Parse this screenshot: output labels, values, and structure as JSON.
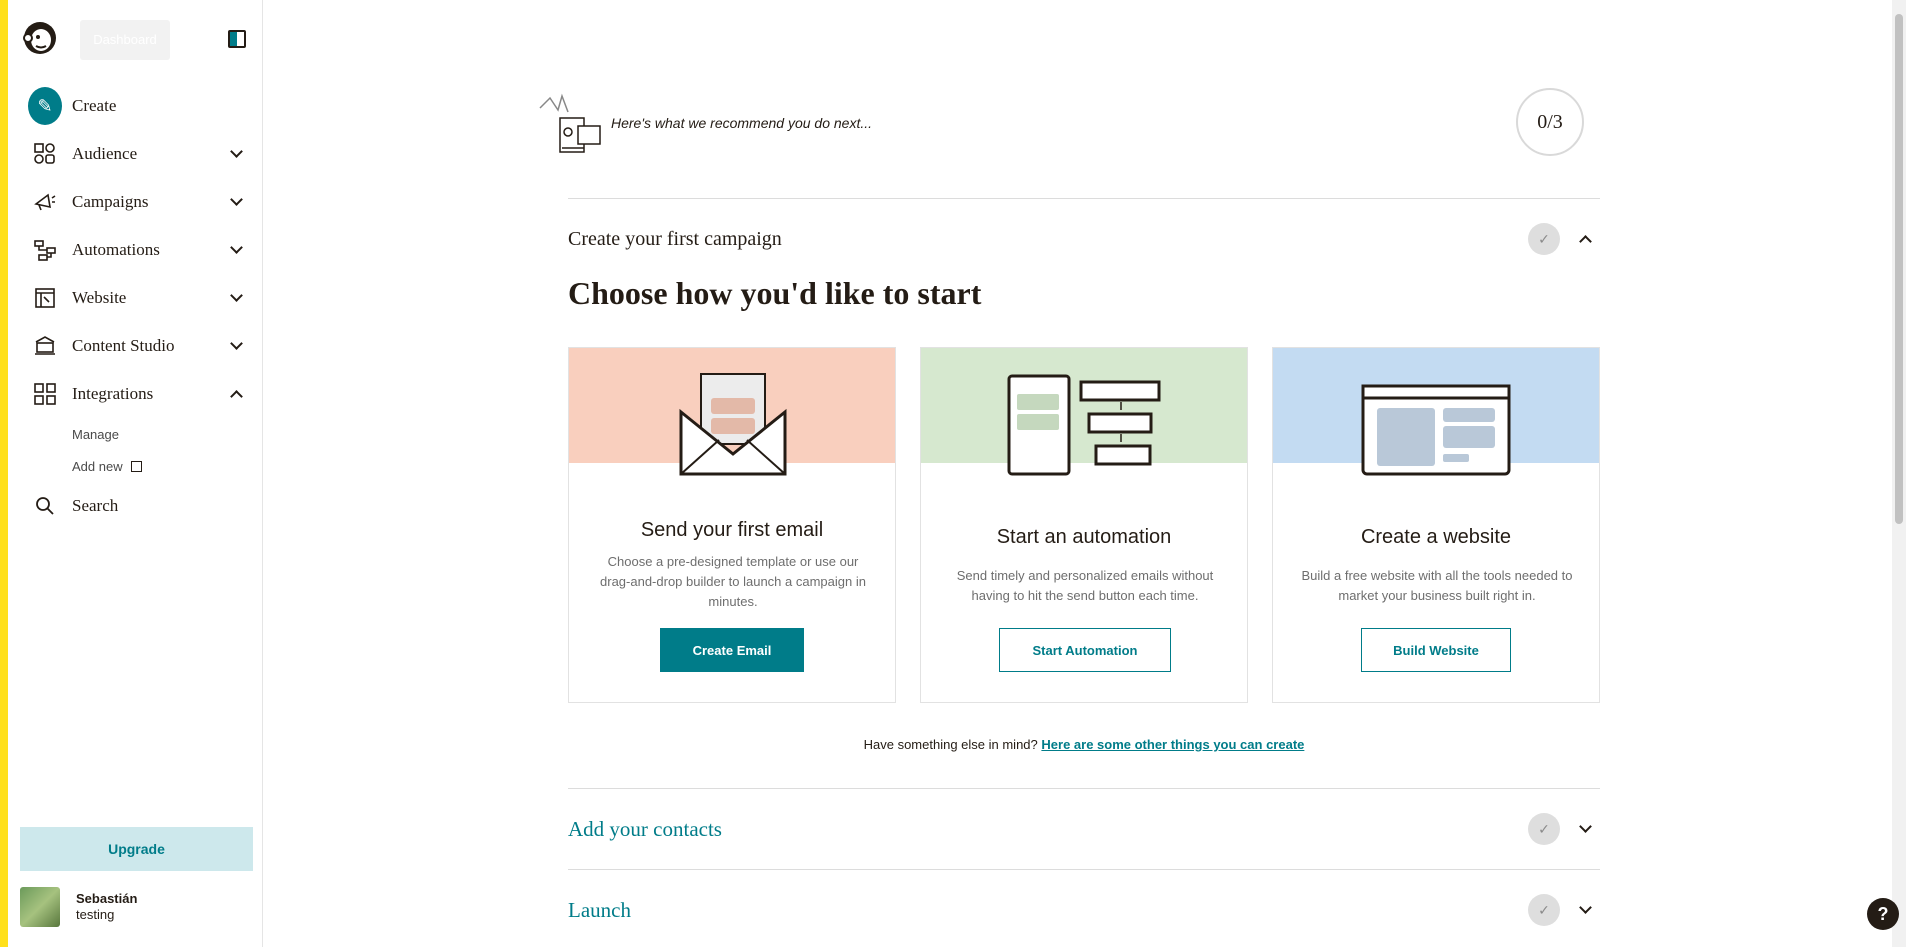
{
  "sidebar": {
    "tooltip": "Dashboard",
    "items": [
      {
        "label": "Create",
        "icon": "pencil-icon"
      },
      {
        "label": "Audience",
        "icon": "audience-icon"
      },
      {
        "label": "Campaigns",
        "icon": "megaphone-icon"
      },
      {
        "label": "Automations",
        "icon": "automation-icon"
      },
      {
        "label": "Website",
        "icon": "website-icon"
      },
      {
        "label": "Content Studio",
        "icon": "content-studio-icon"
      },
      {
        "label": "Integrations",
        "icon": "grid-icon"
      }
    ],
    "integrations_sub": {
      "manage": "Manage",
      "add_new": "Add new"
    },
    "search_label": "Search",
    "upgrade_label": "Upgrade",
    "account": {
      "name": "Sebastián",
      "org": "testing"
    }
  },
  "recommend": {
    "text": "Here's what we recommend you do next...",
    "progress": "0/3"
  },
  "steps": {
    "first": {
      "title": "Create your first campaign",
      "heading": "Choose how you'd like to start"
    },
    "contacts": {
      "title": "Add your contacts"
    },
    "launch": {
      "title": "Launch"
    }
  },
  "cards": [
    {
      "title": "Send your first email",
      "desc": "Choose a pre-designed template or use our drag-and-drop builder to launch a campaign in minutes.",
      "button": "Create Email",
      "bg": "#f9cfbe"
    },
    {
      "title": "Start an automation",
      "desc": "Send timely and personalized emails without having to hit the send button each time.",
      "button": "Start Automation",
      "bg": "#d6e8cf"
    },
    {
      "title": "Create a website",
      "desc": "Build a free website with all the tools needed to market your business built right in.",
      "button": "Build Website",
      "bg": "#c3dbf2"
    }
  ],
  "footer": {
    "prompt": "Have something else in mind?",
    "link": "Here are some other things you can create"
  },
  "colors": {
    "accent": "#007c89",
    "brand_yellow": "#ffe01b"
  }
}
